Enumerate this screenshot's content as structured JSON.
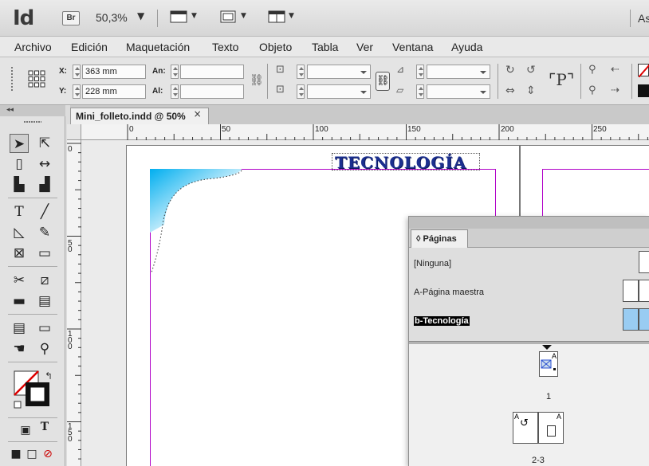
{
  "app": {
    "logo": "Id",
    "bridge": "Br",
    "zoom": "50,3%",
    "workspace_partial": "As"
  },
  "menu": [
    "Archivo",
    "Edición",
    "Maquetación",
    "Texto",
    "Objeto",
    "Tabla",
    "Ver",
    "Ventana",
    "Ayuda"
  ],
  "control": {
    "x_label": "X:",
    "x_value": "363 mm",
    "y_label": "Y:",
    "y_value": "228 mm",
    "w_label": "An:",
    "w_value": "",
    "h_label": "Al:",
    "h_value": ""
  },
  "document": {
    "tab_title": "Mini_folleto.indd @ 50%",
    "close_glyph": "×",
    "heading": "TECNOLOGÍA"
  },
  "rulers": {
    "h_ticks": [
      "0",
      "50",
      "100",
      "150",
      "200",
      "250"
    ],
    "v_ticks": [
      "0",
      "50",
      "100",
      "150"
    ]
  },
  "pages_panel": {
    "tab": "Páginas",
    "masters": [
      {
        "label": "[Ninguna]"
      },
      {
        "label": "A-Página maestra"
      },
      {
        "label": "b-Tecnología",
        "selected": true
      }
    ],
    "page_numbers": [
      "1",
      "2-3"
    ],
    "master_letter": "A"
  },
  "colors": {
    "accent_margin": "#b000c8",
    "heading": "#1b2f8f",
    "selection": "#99ccf2"
  }
}
